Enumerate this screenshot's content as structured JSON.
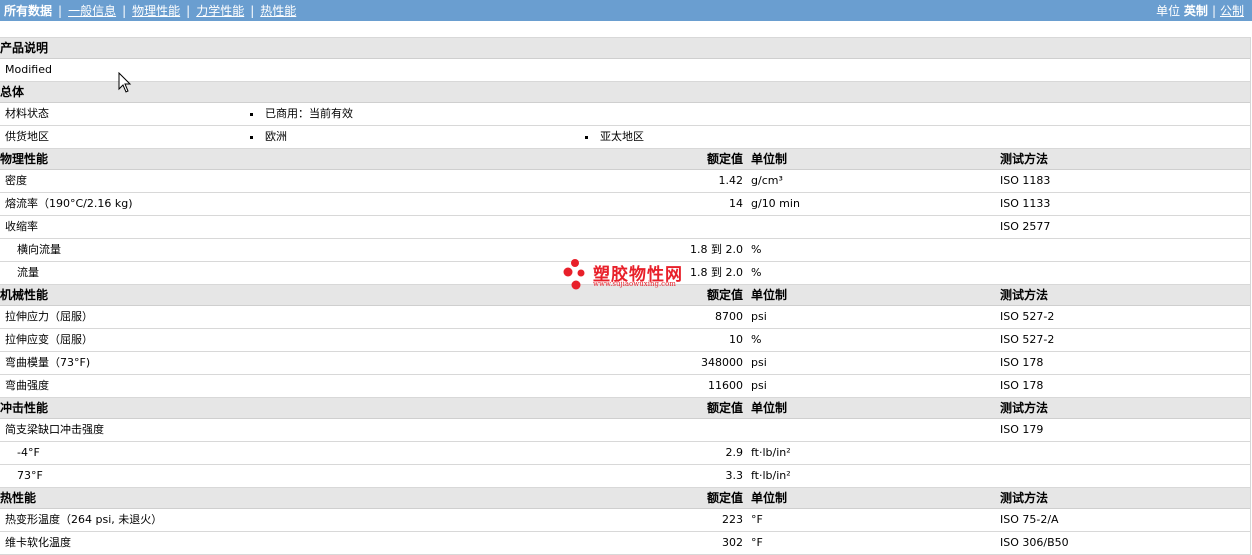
{
  "nav": {
    "tabs": [
      "所有数据",
      "一般信息",
      "物理性能",
      "力学性能",
      "热性能"
    ],
    "active_index": 0,
    "units_label": "单位",
    "unit_options": [
      "英制",
      "公制"
    ],
    "selected_unit_index": 0
  },
  "product_description": {
    "title": "产品说明",
    "text": "Modified"
  },
  "general": {
    "title": "总体",
    "rows": [
      {
        "label": "材料状态",
        "values": [
          "已商用：当前有效"
        ]
      },
      {
        "label": "供货地区",
        "values": [
          "欧洲",
          "亚太地区"
        ]
      }
    ]
  },
  "physical": {
    "title": "物理性能",
    "col_value": "额定值",
    "col_unit": "单位制",
    "col_method": "测试方法",
    "rows": [
      {
        "label": "密度",
        "value": "1.42",
        "unit": "g/cm³",
        "method": "ISO 1183"
      },
      {
        "label": "熔流率（190°C/2.16 kg)",
        "value": "14",
        "unit": "g/10 min",
        "method": "ISO 1133"
      },
      {
        "label": "收缩率",
        "value": "",
        "unit": "",
        "method": "ISO 2577"
      },
      {
        "label": "横向流量",
        "value": "1.8 到  2.0",
        "unit": "%",
        "method": "",
        "indent": true
      },
      {
        "label": "流量",
        "value": "1.8 到  2.0",
        "unit": "%",
        "method": "",
        "indent": true
      }
    ]
  },
  "mechanical": {
    "title": "机械性能",
    "col_value": "额定值",
    "col_unit": "单位制",
    "col_method": "测试方法",
    "rows": [
      {
        "label": "拉伸应力（屈服）",
        "value": "8700",
        "unit": "psi",
        "method": "ISO 527-2"
      },
      {
        "label": "拉伸应变（屈服）",
        "value": "10",
        "unit": "%",
        "method": "ISO 527-2"
      },
      {
        "label": "弯曲模量（73°F)",
        "value": "348000",
        "unit": "psi",
        "method": "ISO 178"
      },
      {
        "label": "弯曲强度",
        "value": "11600",
        "unit": "psi",
        "method": "ISO 178"
      }
    ]
  },
  "impact": {
    "title": "冲击性能",
    "col_value": "额定值",
    "col_unit": "单位制",
    "col_method": "测试方法",
    "rows": [
      {
        "label": "简支梁缺口冲击强度",
        "value": "",
        "unit": "",
        "method": "ISO 179"
      },
      {
        "label": "-4°F",
        "value": "2.9",
        "unit": "ft·lb/in²",
        "method": "",
        "indent": true
      },
      {
        "label": "73°F",
        "value": "3.3",
        "unit": "ft·lb/in²",
        "method": "",
        "indent": true
      }
    ]
  },
  "thermal": {
    "title": "热性能",
    "col_value": "额定值",
    "col_unit": "单位制",
    "col_method": "测试方法",
    "rows": [
      {
        "label": "热变形温度（264 psi, 未退火）",
        "value": "223",
        "unit": "°F",
        "method": "ISO 75-2/A"
      },
      {
        "label": "维卡软化温度",
        "value": "302",
        "unit": "°F",
        "method": "ISO 306/B50"
      }
    ]
  },
  "watermark": {
    "title": "塑胶物性网",
    "url": "www.sujiaowuxing.com"
  },
  "colors": {
    "topbar": "#6a9ed0",
    "section_bg": "#e6e6e6",
    "watermark": "#e8202a"
  }
}
